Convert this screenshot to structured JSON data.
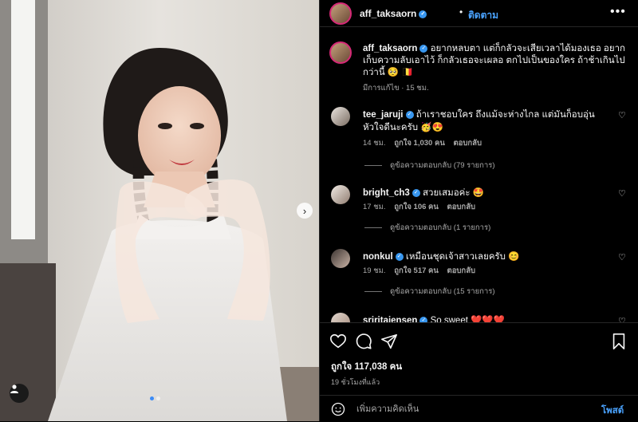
{
  "header": {
    "username": "aff_taksaorn",
    "dot": "•",
    "follow_label": "ติดตาม",
    "more_icon": "more-horizontal-icon"
  },
  "caption": {
    "username": "aff_taksaorn",
    "text": "อยากหลบตา แต่ก็กลัวจะเสียเวลาได้มองเธอ อยากเก็บความลับเอาไว้ ก็กลัวเธอจะเผลอ ตกไปเป็นของใคร ถ้าช้าเกินไปกว่านี้ 🥺 🇧🇪",
    "meta": "มีการแก้ไข · 15 ชม."
  },
  "comments": [
    {
      "username": "tee_jaruji",
      "text": "ถ้าเราชอบใคร ถึงแม้จะห่างไกล แต่มันก็อบอุ่นหัวใจดีนะครับ 🥳😍",
      "time": "14 ชม.",
      "likes": "ถูกใจ 1,030 คน",
      "reply": "ตอบกลับ",
      "view_replies": "ดูข้อความตอบกลับ (79 รายการ)"
    },
    {
      "username": "bright_ch3",
      "text": "สวยเสมอค่ะ 🤩",
      "time": "17 ชม.",
      "likes": "ถูกใจ 106 คน",
      "reply": "ตอบกลับ",
      "view_replies": "ดูข้อความตอบกลับ (1 รายการ)"
    },
    {
      "username": "nonkul",
      "text": "เหมือนชุดเจ้าสาวเลยครับ 😊",
      "time": "19 ชม.",
      "likes": "ถูกใจ 517 คน",
      "reply": "ตอบกลับ",
      "view_replies": "ดูข้อความตอบกลับ (15 รายการ)"
    },
    {
      "username": "sriritajensen",
      "text": "So sweet ❤️❤️❤️"
    }
  ],
  "actions": {
    "likes": "ถูกใจ 117,038 คน",
    "time": "19 ชั่วโมงที่แล้ว"
  },
  "comment_bar": {
    "placeholder": "เพิ่มความคิดเห็น",
    "post_label": "โพสต์"
  },
  "colors": {
    "accent": "#4aa3ff",
    "verified": "#3897f0",
    "background": "#000000",
    "carousel_dot_active": "#3b8bf6"
  }
}
